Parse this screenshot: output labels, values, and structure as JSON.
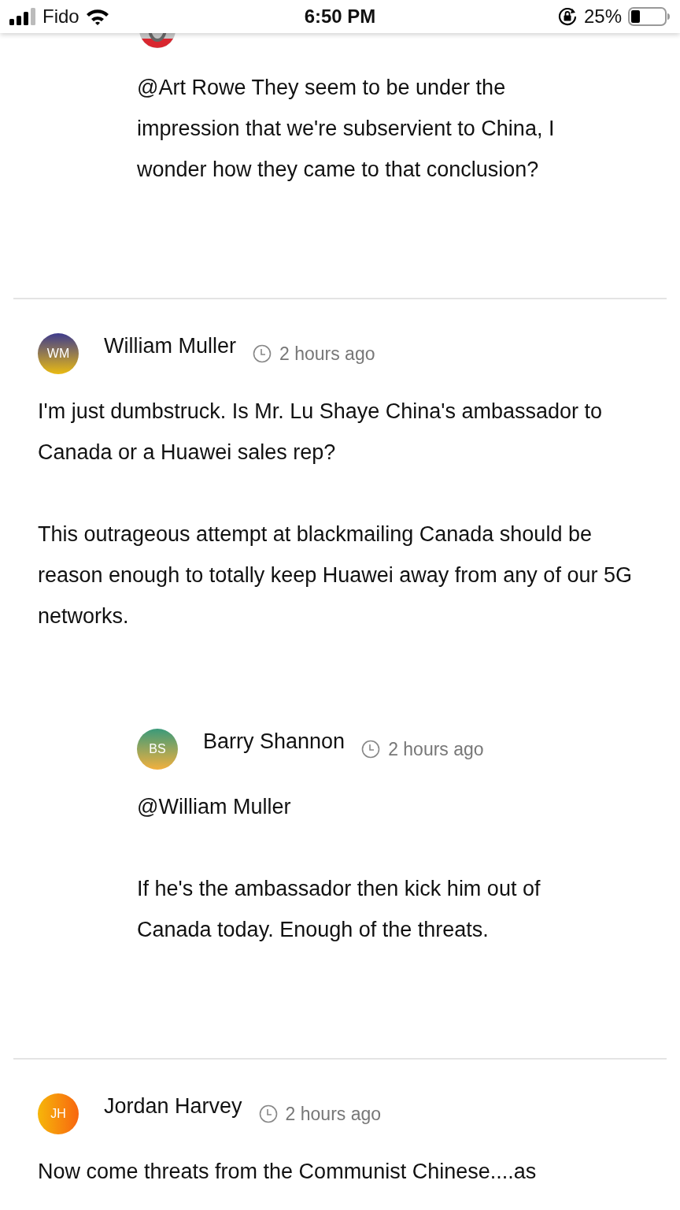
{
  "status_bar": {
    "carrier": "Fido",
    "time": "6:50 PM",
    "battery": "25%"
  },
  "reply_fragment": {
    "paragraphs": [
      "@Art Rowe They seem to be under the impression that we're subservient to China, I wonder how they came to that conclusion?"
    ]
  },
  "comments": [
    {
      "author": "William Muller",
      "initials": "WM",
      "time": "2 hours ago",
      "paragraphs": [
        "I'm just dumbstruck. Is Mr. Lu Shaye China's ambassador to Canada or a Huawei sales rep?",
        "This outrageous attempt at blackmailing Canada should be reason enough to totally keep Huawei away from any of our 5G networks."
      ],
      "replies": [
        {
          "author": "Barry Shannon",
          "initials": "BS",
          "time": "2 hours ago",
          "paragraphs": [
            "@William Muller",
            "If he's the ambassador then kick him out of Canada today. Enough of the threats."
          ]
        }
      ]
    },
    {
      "author": "Jordan Harvey",
      "initials": "JH",
      "time": "2 hours ago",
      "paragraphs": [
        "Now come threats from the Communist Chinese....as"
      ]
    }
  ]
}
